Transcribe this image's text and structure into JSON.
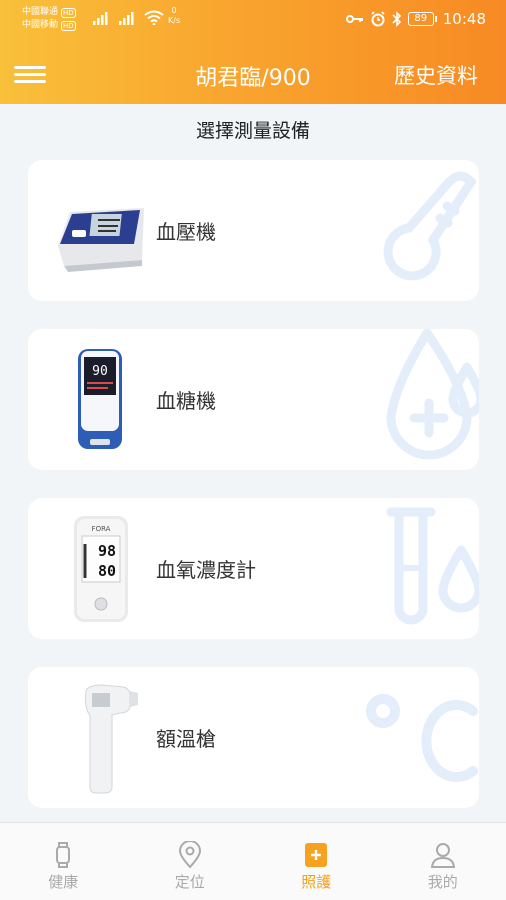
{
  "status_bar": {
    "carrier_1": "中國聯通",
    "carrier_2": "中國移動",
    "hd_badge": "HD",
    "net_speed_value": "0",
    "net_speed_unit": "K/s",
    "battery": "89",
    "time": "10:48"
  },
  "header": {
    "title": "胡君臨/900",
    "history_label": "歷史資料"
  },
  "section_title": "選擇測量設備",
  "devices": [
    {
      "label": "血壓機",
      "icon": "thermometer-icon"
    },
    {
      "label": "血糖機",
      "icon": "blood-drop-plus-icon"
    },
    {
      "label": "血氧濃度計",
      "icon": "test-tube-drop-icon"
    },
    {
      "label": "額溫槍",
      "icon": "celsius-icon"
    }
  ],
  "device_screens": {
    "glucose_reading": "90",
    "oximeter_brand": "FORA",
    "oximeter_spo2": "98",
    "oximeter_pulse": "80"
  },
  "tabs": [
    {
      "label": "健康",
      "icon": "watch-icon",
      "active": false
    },
    {
      "label": "定位",
      "icon": "location-pin-icon",
      "active": false
    },
    {
      "label": "照護",
      "icon": "care-box-icon",
      "active": true
    },
    {
      "label": "我的",
      "icon": "user-icon",
      "active": false
    }
  ],
  "colors": {
    "header_start": "#f9c03a",
    "header_end": "#f78a24",
    "watermark": "#e6f1fb",
    "active_tab": "#f3a01f",
    "inactive_tab": "#aaaaaa"
  }
}
